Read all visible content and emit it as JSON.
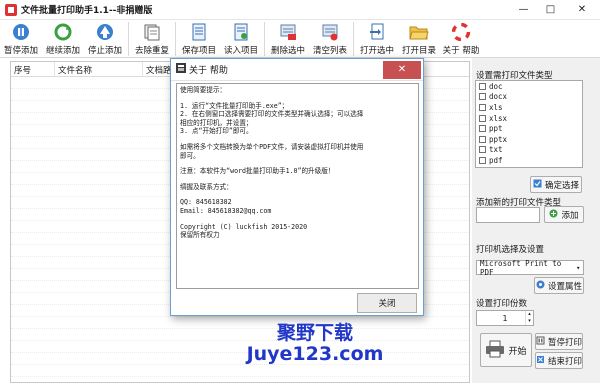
{
  "window": {
    "title": "文件批量打印助手1.1--非捐赠版"
  },
  "toolbar": [
    {
      "label": "暂停添加",
      "icon": "pause-add-icon"
    },
    {
      "label": "继续添加",
      "icon": "continue-add-icon"
    },
    {
      "label": "停止添加",
      "icon": "stop-add-icon"
    },
    {
      "label": "去除重复",
      "icon": "remove-duplicates-icon"
    },
    {
      "label": "保存项目",
      "icon": "save-project-icon"
    },
    {
      "label": "读入项目",
      "icon": "load-project-icon"
    },
    {
      "label": "删除选中",
      "icon": "delete-selected-icon"
    },
    {
      "label": "清空列表",
      "icon": "clear-list-icon"
    },
    {
      "label": "打开选中",
      "icon": "open-selected-icon"
    },
    {
      "label": "打开目录",
      "icon": "open-folder-icon"
    },
    {
      "label": "关于 帮助",
      "icon": "help-icon"
    }
  ],
  "list": {
    "columns": [
      "序号",
      "文件名称",
      "文档路径"
    ]
  },
  "right": {
    "filetype_label": "设置需打印文件类型",
    "filetypes": [
      "doc",
      "docx",
      "xls",
      "xlsx",
      "ppt",
      "pptx",
      "txt",
      "pdf"
    ],
    "confirm_label": "确定选择",
    "add_type_label": "添加新的打印文件类型",
    "add_label": "添加",
    "printer_label": "打印机选择及设置",
    "printer_value": "Microsoft Print to PDF",
    "printer_props_label": "设置属性",
    "copies_label": "设置打印份数",
    "copies_value": "1",
    "start_label": "开始",
    "pause_label": "暂停打印",
    "end_label": "结束打印"
  },
  "dialog": {
    "title": "关于 帮助",
    "lines": [
      "使用简要提示：",
      "",
      "1. 运行“文件批量打印助手.exe”；",
      "2. 在右侧窗口选择需要打印的文件类型并确认选择；可以选择",
      "相应的打印机，并设置；",
      "3. 点“开始打印”即可。",
      "",
      "如需将多个文档转换为单个PDF文件，请安装虚拟打印机并使用",
      "即可。",
      "",
      "注意：本软件为“word批量打印助手1.0”的升级版！",
      "",
      "绸握及联系方式：",
      "",
      "QQ: 845618382",
      "Email: 845618382@qq.com",
      "",
      "Copyright (C) luckfish 2015-2020",
      "保留所有权力"
    ],
    "ok_label": "关闭"
  },
  "watermark": {
    "line1": "聚野下载",
    "line2": "Juye123.com"
  }
}
